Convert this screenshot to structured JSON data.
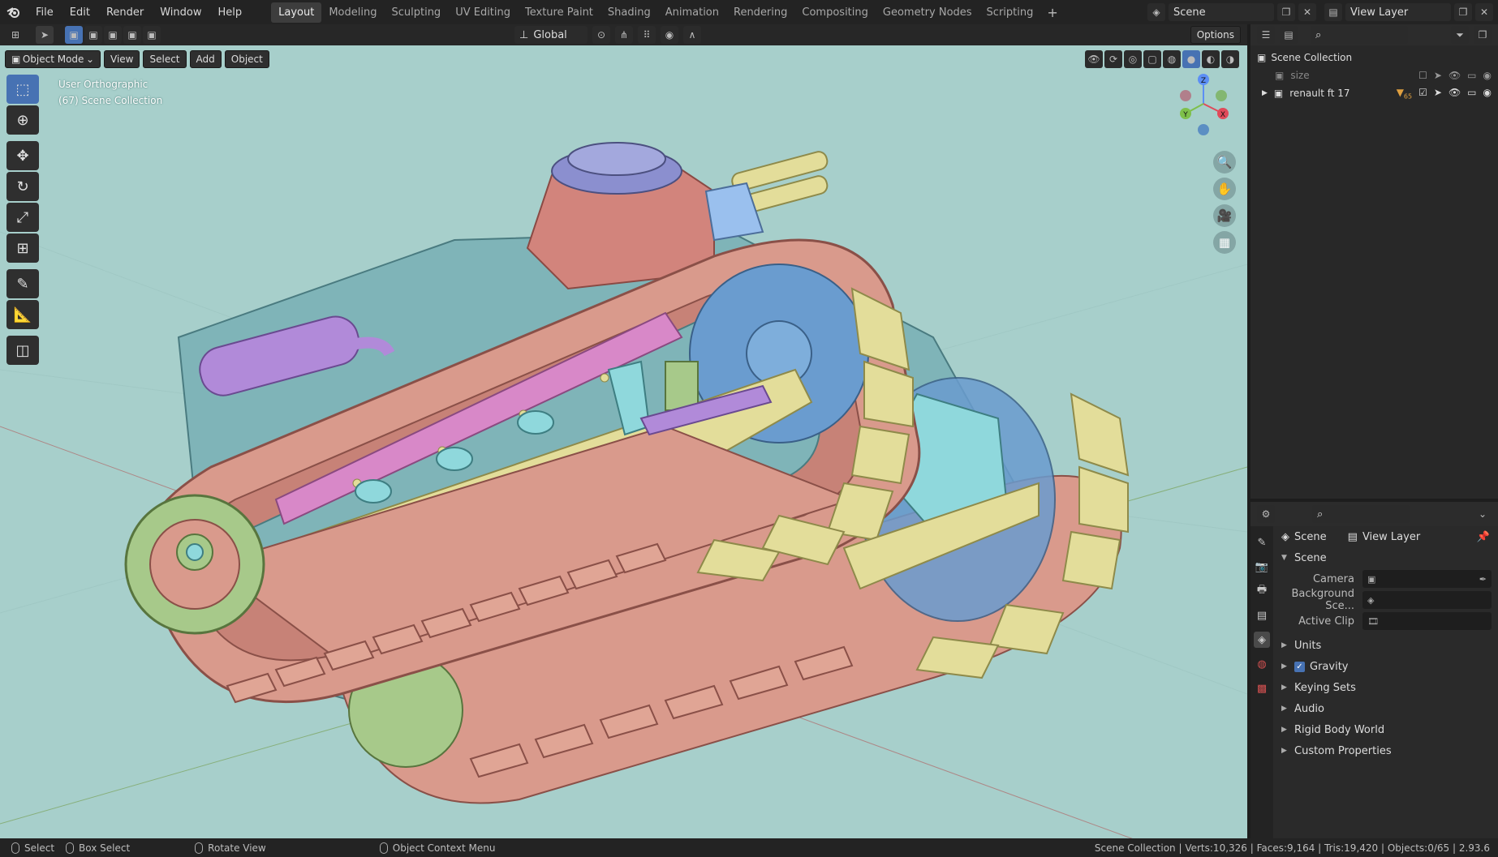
{
  "topbar": {
    "menus": [
      "File",
      "Edit",
      "Render",
      "Window",
      "Help"
    ],
    "workspaces": [
      "Layout",
      "Modeling",
      "Sculpting",
      "UV Editing",
      "Texture Paint",
      "Shading",
      "Animation",
      "Rendering",
      "Compositing",
      "Geometry Nodes",
      "Scripting"
    ],
    "add_workspace": "+",
    "scene_name": "Scene",
    "view_layer_name": "View Layer"
  },
  "header": {
    "orientation": "Global",
    "options": "Options"
  },
  "viewport": {
    "mode": "Object Mode",
    "menu_view": "View",
    "menu_select": "Select",
    "menu_add": "Add",
    "menu_object": "Object",
    "view_name": "User Orthographic",
    "collection_info": "(67) Scene Collection",
    "gizmo_axes": {
      "x": "X",
      "y": "Y",
      "z": "Z"
    },
    "bg_color": "#a7cfcb"
  },
  "outliner": {
    "root": "Scene Collection",
    "items": [
      {
        "name": "size"
      },
      {
        "name": "renault ft 17"
      }
    ],
    "badge": "65"
  },
  "properties": {
    "scene_tab": "Scene",
    "view_layer_tab": "View Layer",
    "section_title": "Scene",
    "camera_label": "Camera",
    "background_label": "Background Sce...",
    "active_clip_label": "Active Clip",
    "sections": [
      "Units",
      "Gravity",
      "Keying Sets",
      "Audio",
      "Rigid Body World",
      "Custom Properties"
    ]
  },
  "statusbar": {
    "select": "Select",
    "box_select": "Box Select",
    "rotate_view": "Rotate View",
    "context_menu": "Object Context Menu",
    "stats": "Scene Collection | Verts:10,326 | Faces:9,164 | Tris:19,420 | Objects:0/65 | 2.93.6"
  },
  "colors": {
    "accent": "#4772b3",
    "track_pink": "#d99a8c",
    "track_yellow": "#e3dd9a",
    "hull_teal": "#88c0c4",
    "gear_green": "#a7c98a",
    "exhaust_purple": "#b18ad9"
  }
}
